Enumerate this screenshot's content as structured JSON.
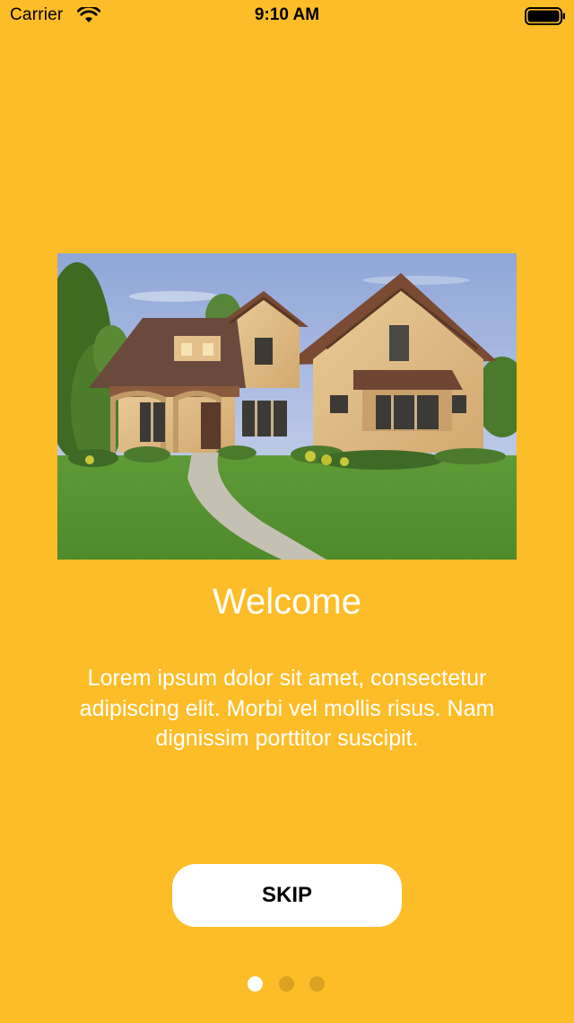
{
  "status_bar": {
    "carrier": "Carrier",
    "time": "9:10 AM"
  },
  "onboarding": {
    "image_icon": "house-photo",
    "title": "Welcome",
    "description": "Lorem ipsum dolor sit amet, consectetur adipiscing elit. Morbi vel mollis risus. Nam dignissim porttitor suscipit.",
    "skip_label": "SKIP",
    "page_count": 3,
    "current_page": 1
  },
  "colors": {
    "background": "#FDBD28",
    "button_bg": "#FFFFFF",
    "dot_inactive": "#D9A220",
    "dot_active": "#FFFFFF",
    "text": "#FFFFFF"
  }
}
